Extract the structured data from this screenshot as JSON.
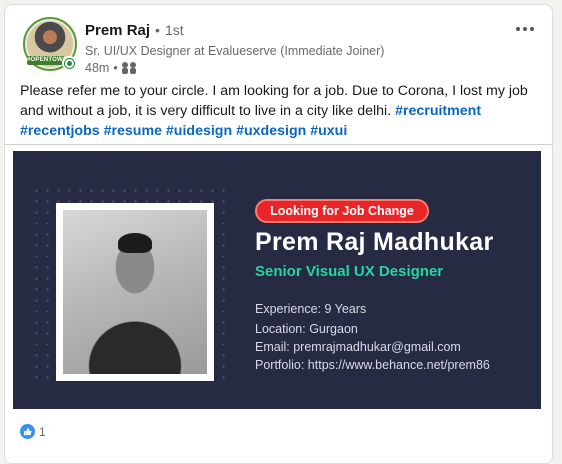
{
  "post": {
    "author": {
      "name": "Prem Raj",
      "separator": "•",
      "connection_degree": "1st",
      "headline": "Sr. UI/UX Designer at Evalueserve (Immediate Joiner)",
      "posted_ago": "48m",
      "meta_separator": "•",
      "visibility_icon": "connections-icon",
      "avatar_badge": "#OPENTOWORK",
      "online": true
    },
    "more_icon": "more-horizontal-icon",
    "text": "Please refer me to your circle. I am looking for a job. Due to Corona, I lost my job and without a job, it is very difficult to live in a city like delhi.",
    "hashtags": [
      "#recruitment",
      "#recentjobs",
      "#resume",
      "#uidesign",
      "#uxdesign",
      "#uxui"
    ],
    "banner": {
      "badge": "Looking for Job Change",
      "name": "Prem Raj Madhukar",
      "role": "Senior Visual UX Designer",
      "experience": "Experience: 9 Years",
      "location": "Location: Gurgaon",
      "email": "Email: premrajmadhukar@gmail.com",
      "portfolio": "Portfolio: https://www.behance.net/prem86"
    },
    "reactions": {
      "icon": "like-icon",
      "count": "1"
    }
  },
  "colors": {
    "hashtag": "#0a66c2",
    "banner_bg": "#272a43",
    "badge_red": "#e8262a",
    "role_green": "#27d4a4",
    "like_blue": "#378fe9"
  }
}
